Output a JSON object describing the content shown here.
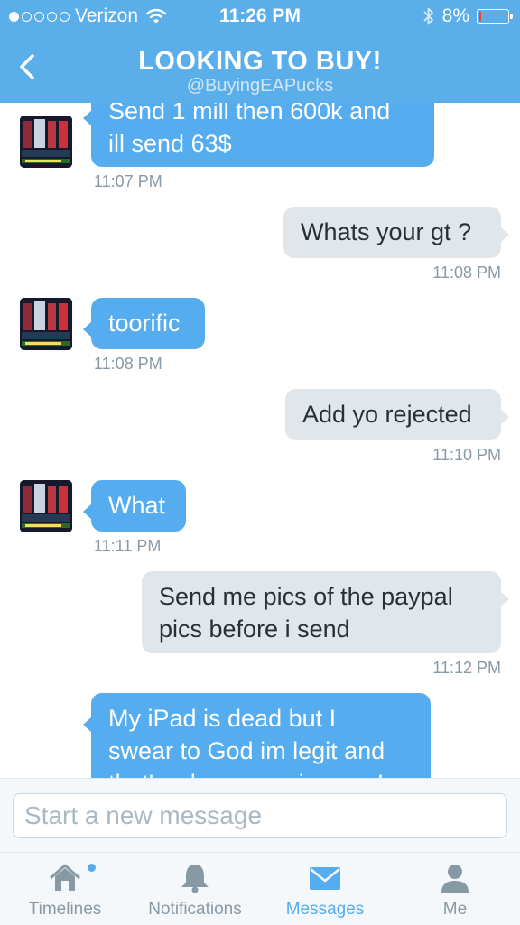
{
  "status_bar": {
    "carrier": "Verizon",
    "time": "11:26 PM",
    "battery": "8%",
    "battery_level": 0.08,
    "signal_icon": "signal-dots-icon",
    "wifi_icon": "wifi-icon",
    "bluetooth_icon": "bluetooth-icon"
  },
  "header": {
    "title": "LOOKING TO BUY!",
    "handle": "@BuyingEAPucks",
    "back_icon": "chevron-left-icon"
  },
  "messages": [
    {
      "direction": "in",
      "lines": [
        "Send 1 mill then 600k and",
        "ill send 63$"
      ],
      "time": "11:07 PM"
    },
    {
      "direction": "out",
      "lines": [
        "Whats your gt ?"
      ],
      "time": "11:08 PM"
    },
    {
      "direction": "in",
      "lines": [
        "toorific"
      ],
      "time": "11:08 PM"
    },
    {
      "direction": "out",
      "lines": [
        "Add yo rejected"
      ],
      "time": "11:10 PM"
    },
    {
      "direction": "in",
      "lines": [
        "What"
      ],
      "time": "11:11 PM"
    },
    {
      "direction": "out",
      "lines": [
        "Send me pics of the paypal",
        "pics before i send"
      ],
      "time": "11:12 PM"
    },
    {
      "direction": "in",
      "lines": [
        "My iPad is dead but I",
        "swear to God im legit and",
        "that's where my pics are I"
      ],
      "time": ""
    }
  ],
  "composer": {
    "placeholder": "Start a new message"
  },
  "tabbar": {
    "tabs": [
      {
        "label": "Timelines",
        "icon": "home-icon"
      },
      {
        "label": "Notifications",
        "icon": "bell-icon"
      },
      {
        "label": "Messages",
        "icon": "envelope-icon",
        "active": true
      },
      {
        "label": "Me",
        "icon": "person-icon"
      }
    ]
  },
  "colors": {
    "accent": "#55acee",
    "header": "#5aaeea",
    "incoming_bubble": "#55acee",
    "outgoing_bubble": "#e1e6ea",
    "timestamp": "#8899a6",
    "battery_low": "#ff3b30"
  }
}
